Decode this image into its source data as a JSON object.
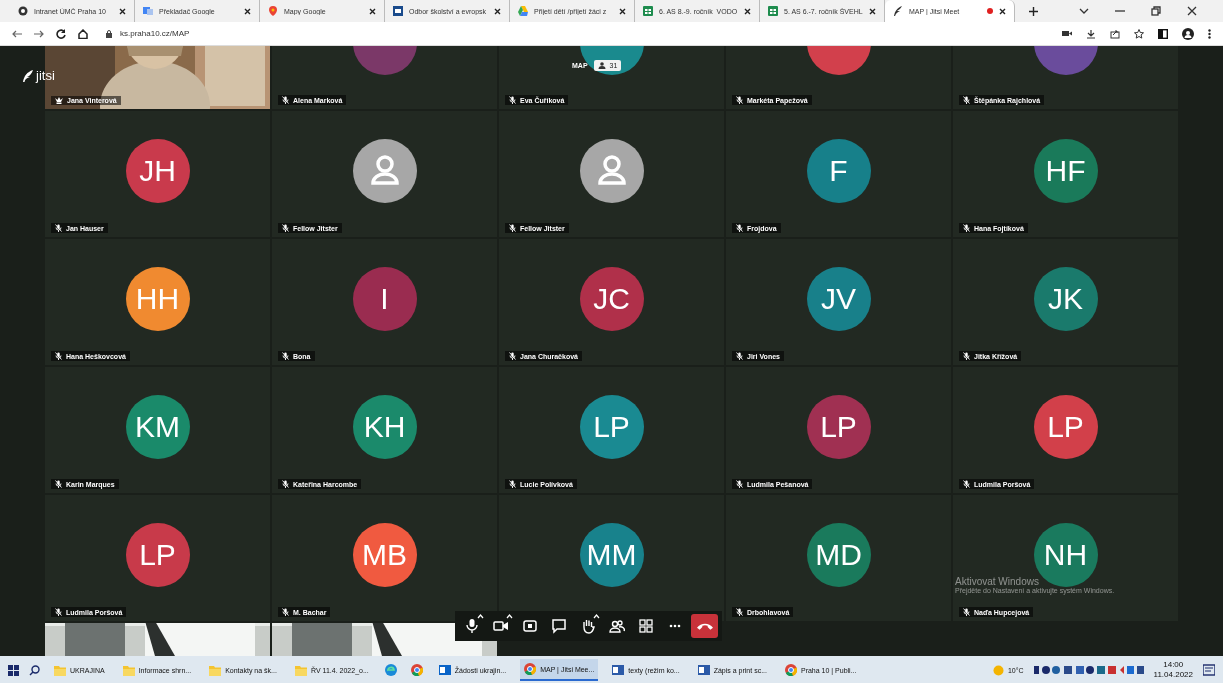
{
  "browser": {
    "tabs": [
      {
        "kind": "globe",
        "label": "Intranet ÚMČ Praha 10",
        "selected": false
      },
      {
        "kind": "translate",
        "label": "Překladač Google",
        "selected": false
      },
      {
        "kind": "pin",
        "label": "Mapy Google",
        "selected": false
      },
      {
        "kind": "doc",
        "label": "Odbor školství a evropsk",
        "selected": false
      },
      {
        "kind": "drive",
        "label": "Přijetí dětí /přijetí žáci z",
        "selected": false
      },
      {
        "kind": "sheet",
        "label": "6. AS 8.-9. ročník_VODO",
        "selected": false
      },
      {
        "kind": "sheet",
        "label": "5. AS 6.-7. ročník ŠVEHL",
        "selected": false
      },
      {
        "kind": "jitsi",
        "label": "MAP | Jitsi Meet",
        "selected": true,
        "recording": true
      }
    ],
    "address": "ks.praha10.cz/MAP"
  },
  "meeting": {
    "logo": "jitsi",
    "room_label": "MAP",
    "participant_count": "31",
    "participants": [
      {
        "kind": "video",
        "name": "Jana Vinterová",
        "moderator": true
      },
      {
        "kind": "avatar",
        "name": "Alena Marková",
        "color": "#7b3868"
      },
      {
        "kind": "avatar",
        "name": "Eva Čuříková",
        "color": "#1a8a8e"
      },
      {
        "kind": "avatar",
        "name": "Markéta Papežová",
        "color": "#d2404c"
      },
      {
        "kind": "avatar",
        "name": "Štěpánka Rajchlová",
        "color": "#6a4c9c"
      },
      {
        "kind": "avatar",
        "name": "Jan Hauser",
        "initials": "JH",
        "color": "#c93a4c"
      },
      {
        "kind": "generic",
        "name": "Fellow Jitster"
      },
      {
        "kind": "generic",
        "name": "Fellow Jitster"
      },
      {
        "kind": "avatar",
        "name": "Frojdova",
        "initials": "F",
        "color": "#17808a"
      },
      {
        "kind": "avatar",
        "name": "Hana Fojtíková",
        "initials": "HF",
        "color": "#1a7a5a"
      },
      {
        "kind": "avatar",
        "name": "Hana Heškovcová",
        "initials": "HH",
        "color": "#f08a30"
      },
      {
        "kind": "avatar",
        "name": "Bona",
        "initials": "I",
        "color": "#9a2c50"
      },
      {
        "kind": "avatar",
        "name": "Jana Churačková",
        "initials": "JC",
        "color": "#b0304a"
      },
      {
        "kind": "avatar",
        "name": "Jiri Vones",
        "initials": "JV",
        "color": "#18808a"
      },
      {
        "kind": "avatar",
        "name": "Jitka Křížová",
        "initials": "JK",
        "color": "#1a7a6c"
      },
      {
        "kind": "avatar",
        "name": "Karin Marques",
        "initials": "KM",
        "color": "#1a8a6a"
      },
      {
        "kind": "avatar",
        "name": "Kateřina Harcombe",
        "initials": "KH",
        "color": "#1b8a6b"
      },
      {
        "kind": "avatar",
        "name": "Lucie Polívková",
        "initials": "LP",
        "color": "#1a8a92"
      },
      {
        "kind": "avatar",
        "name": "Ludmila Pešanová",
        "initials": "LP",
        "color": "#a03052"
      },
      {
        "kind": "avatar",
        "name": "Ludmila Poršová",
        "initials": "LP",
        "color": "#d2404a"
      },
      {
        "kind": "avatar",
        "name": "Ludmila Poršová",
        "initials": "LP",
        "color": "#c83a4a"
      },
      {
        "kind": "avatar",
        "name": "M. Bachar",
        "initials": "MB",
        "color": "#f05a40"
      },
      {
        "kind": "avatar",
        "initials": "MM",
        "color": "#18828c"
      },
      {
        "kind": "avatar",
        "name": "Drbohlavová",
        "initials": "MD",
        "color": "#1a7a5c"
      },
      {
        "kind": "avatar",
        "name": "Naďa Hupcejová",
        "initials": "NH",
        "color": "#1a7a5e"
      },
      {
        "kind": "video"
      },
      {
        "kind": "video"
      }
    ],
    "toolbar": [
      {
        "kind": "mic",
        "caret": true
      },
      {
        "kind": "camera",
        "caret": true
      },
      {
        "kind": "share",
        "caret": false
      },
      {
        "kind": "chat",
        "caret": false
      },
      {
        "kind": "hand",
        "caret": true
      },
      {
        "kind": "people",
        "caret": false
      },
      {
        "kind": "tiles",
        "caret": false
      },
      {
        "kind": "more",
        "caret": false
      },
      {
        "kind": "hangup",
        "caret": false
      }
    ],
    "activation": {
      "title": "Aktivovat Windows",
      "text": "Přejděte do Nastavení a aktivujte systém Windows."
    }
  },
  "taskbar": {
    "apps": [
      {
        "kind": "folder",
        "label": "UKRAJINA",
        "selected": false
      },
      {
        "kind": "folder",
        "label": "Informace shrn...",
        "selected": false
      },
      {
        "kind": "folder",
        "label": "Kontakty na šk...",
        "selected": false
      },
      {
        "kind": "folder",
        "label": "ŘV 11.4. 2022_o...",
        "selected": false
      },
      {
        "kind": "edge",
        "selected": false
      },
      {
        "kind": "chrome",
        "selected": false
      },
      {
        "kind": "outlook",
        "label": "Žádosti ukrajin...",
        "selected": false
      },
      {
        "kind": "chrome",
        "label": "MAP | Jitsi Mee...",
        "selected": true
      },
      {
        "kind": "word",
        "label": "texty (režim ko...",
        "selected": false
      },
      {
        "kind": "word",
        "label": "Zápis a print sc...",
        "selected": false
      },
      {
        "kind": "chrome",
        "label": "Praha 10 | Publi...",
        "selected": false
      }
    ],
    "weather": "10°C",
    "time": "14:00",
    "date": "11.04.2022"
  }
}
